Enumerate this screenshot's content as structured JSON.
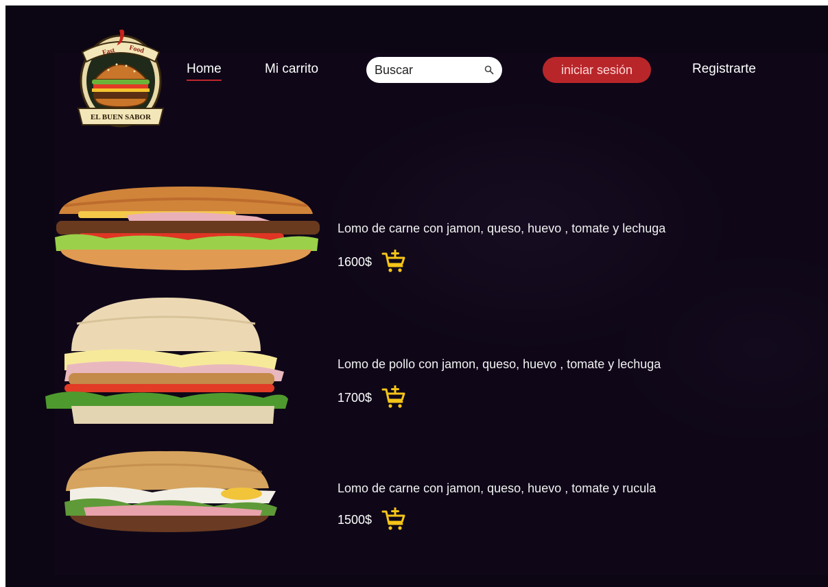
{
  "brand": {
    "top_text": "Fast Food",
    "name": "EL BUEN SABOR"
  },
  "nav": {
    "home": "Home",
    "cart": "Mi carrito",
    "login": "iniciar sesión",
    "register": "Registrarte"
  },
  "search": {
    "placeholder": "Buscar",
    "value": ""
  },
  "products": [
    {
      "description": "Lomo de carne con jamon, queso, huevo , tomate y lechuga",
      "price": "1600$"
    },
    {
      "description": "Lomo de pollo con jamon, queso, huevo , tomate y lechuga",
      "price": "1700$"
    },
    {
      "description": "Lomo de carne con jamon, queso, huevo , tomate y rucula",
      "price": "1500$"
    }
  ],
  "colors": {
    "background": "#0c0614",
    "accent_red": "#b8262a",
    "cart_yellow": "#f5c518",
    "text": "#ffffff"
  },
  "icons": [
    "burger-logo-icon",
    "search-icon",
    "add-to-cart-icon"
  ]
}
